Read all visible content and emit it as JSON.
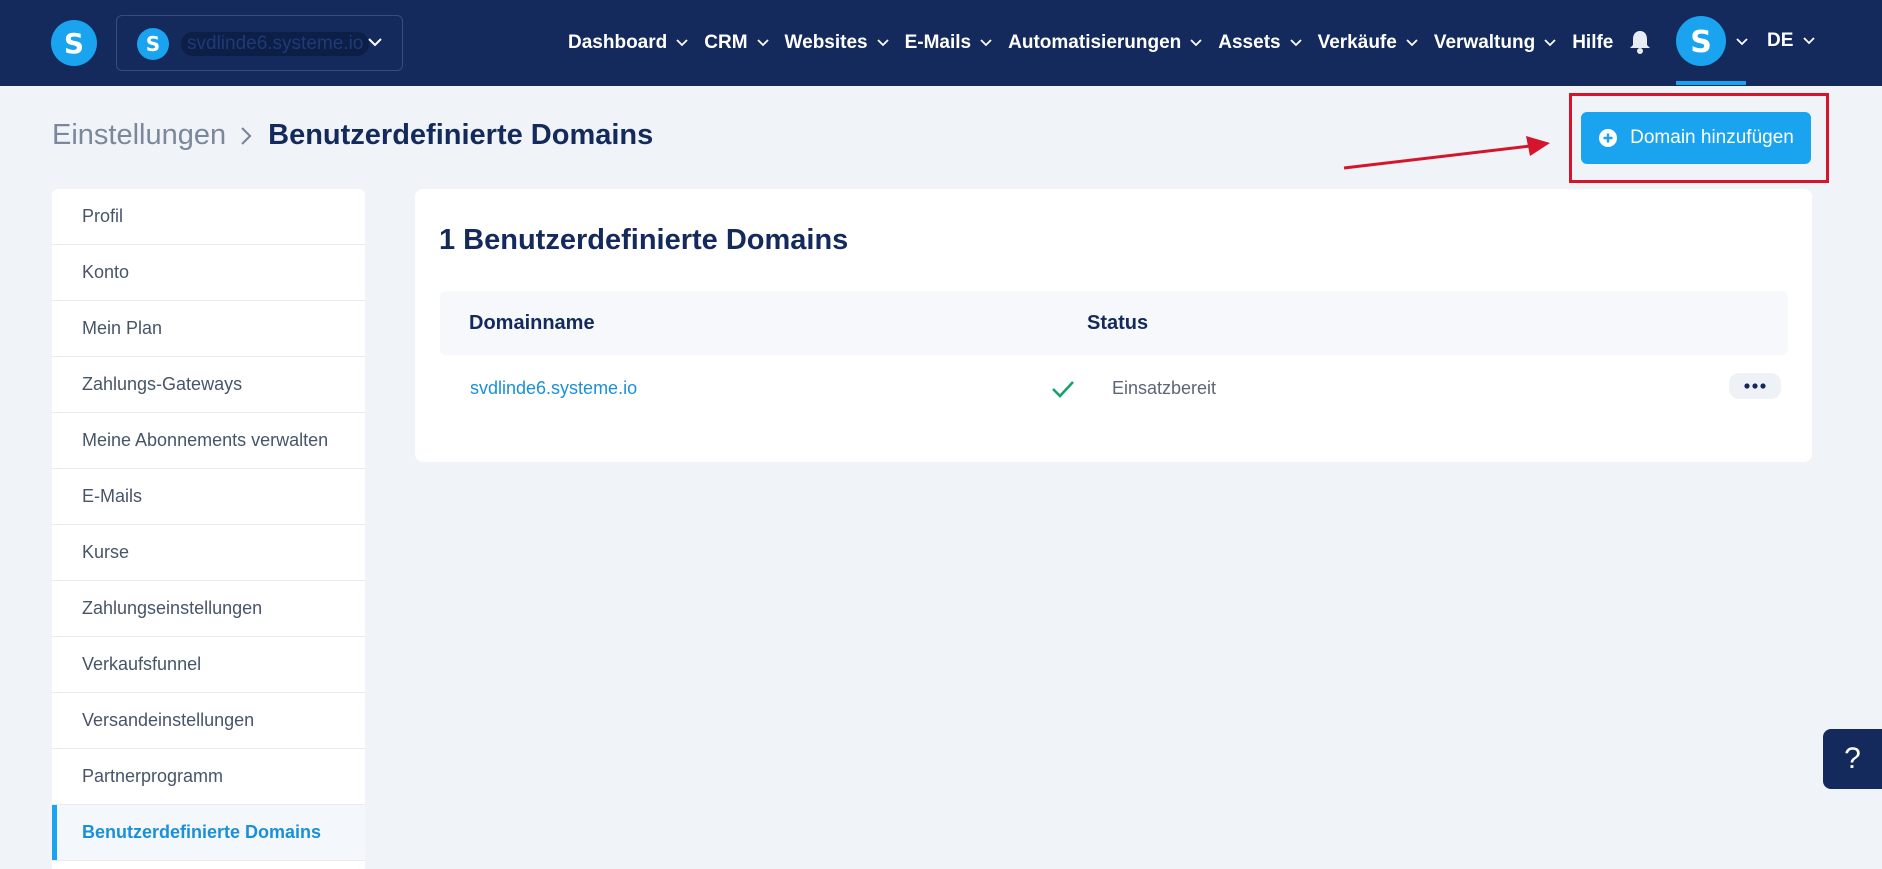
{
  "header": {
    "site_name": "svdlinde6.systeme.io",
    "nav": [
      "Dashboard",
      "CRM",
      "Websites",
      "E-Mails",
      "Automatisierungen",
      "Assets",
      "Verkäufe",
      "Verwaltung",
      "Hilfe"
    ],
    "language": "DE",
    "icons": [
      "systeme-logo-icon",
      "bell-icon",
      "avatar-icon"
    ]
  },
  "breadcrumb": {
    "parent": "Einstellungen",
    "current": "Benutzerdefinierte Domains"
  },
  "actions": {
    "add_domain_label": "Domain hinzufügen"
  },
  "sidebar": {
    "items": [
      {
        "label": "Profil"
      },
      {
        "label": "Konto"
      },
      {
        "label": "Mein Plan"
      },
      {
        "label": "Zahlungs-Gateways"
      },
      {
        "label": "Meine Abonnements verwalten"
      },
      {
        "label": "E-Mails"
      },
      {
        "label": "Kurse"
      },
      {
        "label": "Zahlungseinstellungen"
      },
      {
        "label": "Verkaufsfunnel"
      },
      {
        "label": "Versandeinstellungen"
      },
      {
        "label": "Partnerprogramm"
      },
      {
        "label": "Benutzerdefinierte Domains",
        "active": true
      }
    ]
  },
  "main": {
    "title": "1 Benutzerdefinierte Domains",
    "columns": [
      "Domainname",
      "Status"
    ],
    "rows": [
      {
        "domain": "svdlinde6.systeme.io",
        "status": "Einsatzbereit"
      }
    ]
  },
  "help": {
    "label": "?"
  },
  "colors": {
    "topbar": "#142a5c",
    "accent": "#1aa3ef",
    "annotation": "#d4152b",
    "success": "#16a36b"
  }
}
